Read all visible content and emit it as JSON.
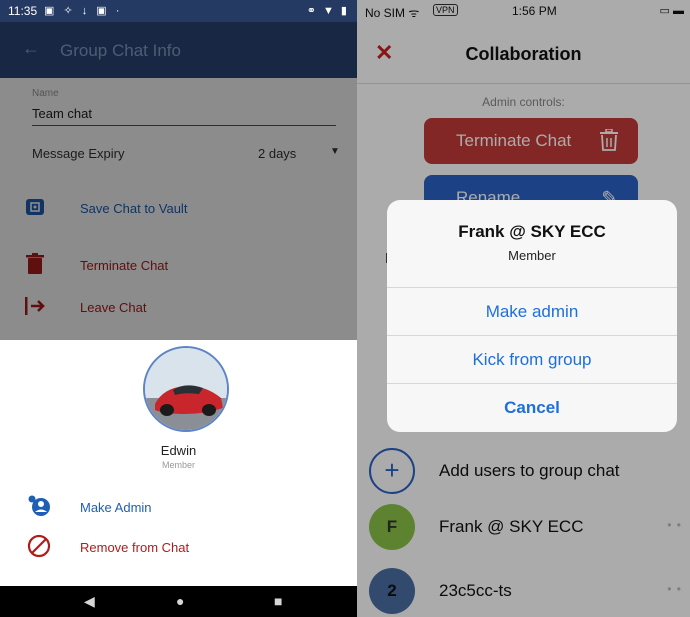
{
  "android": {
    "status": {
      "time": "11:35",
      "icons": "▣ ✧ ↓ ▣ ·",
      "right": "⚭ ▼ ▮"
    },
    "appbar": {
      "back": "←",
      "title": "Group Chat Info"
    },
    "name_label": "Name",
    "name_value": "Team chat",
    "expiry_label": "Message Expiry",
    "expiry_value": "2 days",
    "actions": [
      {
        "label": "Save Chat to Vault",
        "icon": "vault-icon"
      },
      {
        "label": "Terminate Chat",
        "icon": "trash-icon"
      },
      {
        "label": "Leave Chat",
        "icon": "exit-icon"
      }
    ],
    "sheet": {
      "member_name": "Edwin",
      "member_role": "Member",
      "make_admin": "Make Admin",
      "remove": "Remove from Chat"
    },
    "nav": {
      "back": "◀",
      "home": "●",
      "recents": "■"
    },
    "colors": {
      "appbar": "#2d4a7c",
      "blue": "#1e5fb5",
      "red": "#b01c1c"
    }
  },
  "ios": {
    "status": {
      "carrier": "No SIM ᯤ",
      "vpn": "VPN",
      "time": "1:56 PM",
      "battery": "▭ ▬"
    },
    "nav": {
      "close": "✕",
      "title": "Collaboration"
    },
    "admin_label": "Admin controls:",
    "terminate_label": "Terminate Chat",
    "rename_label": "Rename",
    "hidden_letter": "M",
    "alert": {
      "title": "Frank @ SKY ECC",
      "message": "Member",
      "make_admin": "Make admin",
      "kick": "Kick from group",
      "cancel": "Cancel"
    },
    "rows": [
      {
        "avatar": "+",
        "label": "Add users to group chat"
      },
      {
        "avatar": "F",
        "label": "Frank @ SKY ECC",
        "more": "• •"
      },
      {
        "avatar": "2",
        "label": "23c5cc-ts",
        "more": "• •"
      }
    ],
    "colors": {
      "terminate": "#c33a3a",
      "rename": "#2a63c6",
      "alert_button": "#1e6fd9",
      "close": "#c92020"
    }
  }
}
